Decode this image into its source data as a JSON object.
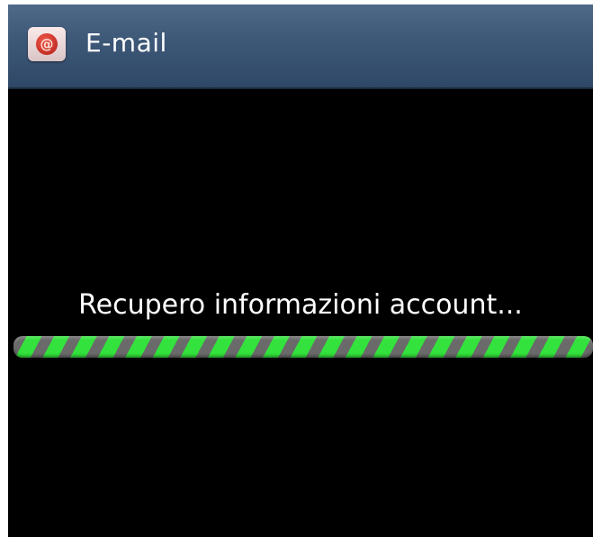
{
  "header": {
    "icon": "email-app-icon",
    "title": "E-mail"
  },
  "main": {
    "status_message": "Recupero informazioni account...",
    "progress_state": "indeterminate"
  },
  "colors": {
    "titlebar": "#3d5777",
    "background": "#000000",
    "progress_stripe": "#33e23c"
  }
}
